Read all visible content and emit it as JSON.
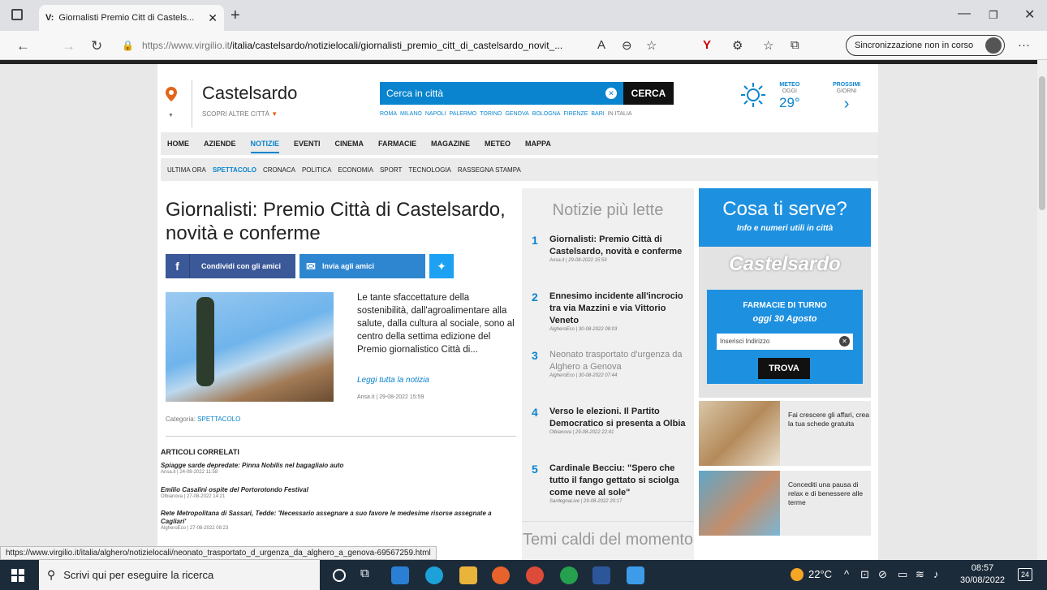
{
  "browser": {
    "tab_title": "Giornalisti Premio Citt di Castels...",
    "tab_favicon": "V:",
    "url_host": "https://www.virgilio.it",
    "url_path": "/italia/castelsardo/notizielocali/giornalisti_premio_citt_di_castelsardo_novit_...",
    "sync_label": "Sincronizzazione non in corso",
    "status_url": "https://www.virgilio.it/italia/alghero/notizielocali/neonato_trasportato_d_urgenza_da_alghero_a_genova-69567259.html"
  },
  "header": {
    "city": "Castelsardo",
    "scopri": "SCOPRI ALTRE CITTÀ",
    "search_placeholder": "Cerca in città",
    "search_button": "CERCA",
    "cities": [
      "ROMA",
      "MILANO",
      "NAPOLI",
      "PALERMO",
      "TORINO",
      "GENOVA",
      "BOLOGNA",
      "FIRENZE",
      "BARI",
      "IN ITALIA"
    ]
  },
  "weather": {
    "label1": "METEO",
    "label2": "OGGI",
    "temp": "29°",
    "next1": "PROSSIMI",
    "next2": "GIORNI",
    "next_arrow": "›"
  },
  "nav_main": [
    "HOME",
    "AZIENDE",
    "NOTIZIE",
    "EVENTI",
    "CINEMA",
    "FARMACIE",
    "MAGAZINE",
    "METEO",
    "MAPPA"
  ],
  "nav_sub": [
    "ULTIMA ORA",
    "SPETTACOLO",
    "CRONACA",
    "POLITICA",
    "ECONOMIA",
    "SPORT",
    "TECNOLOGIA",
    "RASSEGNA STAMPA"
  ],
  "article": {
    "title": "Giornalisti: Premio Città di Castelsardo, novità e conferme",
    "share_fb": "Condividi con gli amici",
    "share_msg": "Invia agli amici",
    "summary": "Le tante sfaccettature della sostenibilità, dall'agroalimentare alla salute, dalla cultura al sociale, sono al centro della settima edizione del Premio giornalistico Città di...",
    "read_more": "Leggi tutta la notizia",
    "source": "Ansa.it | 29-08-2022 15:59",
    "category_label": "Categoria:",
    "category": "SPETTACOLO"
  },
  "related": {
    "heading": "ARTICOLI CORRELATI",
    "items": [
      {
        "title": "Spiagge sarde depredate: Pinna Nobilis nel bagagliaio auto",
        "src": "Ansa.it | 24-08-2022 11:58"
      },
      {
        "title": "Emilio Casalini ospite del Portorotondo Festival",
        "src": "Olbianova | 27-08-2022 14:21"
      },
      {
        "title": "Rete Metropolitana di Sassari, Tedde: 'Necessario assegnare a suo favore le medesime risorse assegnate a Cagliari'",
        "src": "AlgheroEco | 27-08-2022 08:23"
      }
    ]
  },
  "popular": {
    "heading": "Notizie più lette",
    "items": [
      {
        "n": "1",
        "title": "Giornalisti: Premio Città di Castelsardo, novità e conferme",
        "src": "Ansa.it | 29-08-2022 15:59"
      },
      {
        "n": "2",
        "title": "Ennesimo incidente all'incrocio tra via Mazzini e via Vittorio Veneto",
        "src": "AlgheroEco | 30-08-2022 08:03"
      },
      {
        "n": "3",
        "title": "Neonato trasportato d'urgenza da Alghero a Genova",
        "src": "AlgheroEco | 30-08-2022 07:44"
      },
      {
        "n": "4",
        "title": "Verso le elezioni. Il Partito Democratico si presenta a Olbia",
        "src": "Olbianova | 29-08-2022 22:41"
      },
      {
        "n": "5",
        "title": "Cardinale Becciu: \"Spero che tutto il fango gettato si sciolga come neve al sole\"",
        "src": "SardegnaLive | 29-08-2022 20:17"
      }
    ],
    "temi": "Temi caldi del momento"
  },
  "sidebar": {
    "cosa_title": "Cosa ti serve?",
    "cosa_sub": "Info e numeri utili in città",
    "map_city": "Castelsardo",
    "farm_title": "FARMACIE DI TURNO",
    "farm_date": "oggi 30 Agosto",
    "farm_input": "Inserisci Indirizzo",
    "farm_button": "TROVA",
    "promo1": "Fai crescere gli affari, crea la tua schede gratuita",
    "promo2": "Concediti una pausa di relax e di benessere alle terme"
  },
  "taskbar": {
    "search": "Scrivi qui per eseguire la ricerca",
    "temp": "22°C",
    "time": "08:57",
    "date": "30/08/2022",
    "notif": "24"
  }
}
